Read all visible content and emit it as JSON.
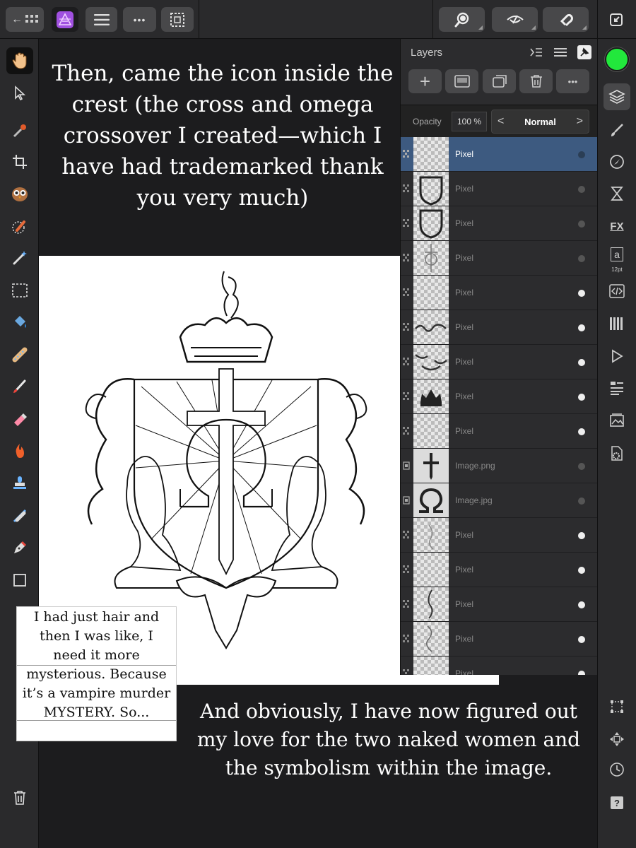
{
  "toolbar": {
    "back_label": "←",
    "more_label": "•••"
  },
  "colors": {
    "primary_color": "#22e83c",
    "selection": "#3d5a80"
  },
  "canvas": {
    "top_text": "Then, came the icon inside the crest (the cross and omega crossover I created—which I have had trademarked thank you very much)",
    "note_text": "I had just hair and then I was like, I need it more mysterious. Because it’s a vampire murder MYSTERY. So...",
    "bottom_text": "And obviously, I have now figured out my love for the two naked women and the symbolism within the image."
  },
  "layers_panel": {
    "title": "Layers",
    "opacity_label": "Opacity",
    "opacity_value": "100 %",
    "blend_mode": "Normal",
    "blend_prev": "<",
    "blend_next": ">",
    "add_label": "+",
    "more_label": "•••",
    "layers": [
      {
        "name": "Pixel",
        "selected": true
      },
      {
        "name": "Pixel"
      },
      {
        "name": "Pixel"
      },
      {
        "name": "Pixel"
      },
      {
        "name": "Pixel"
      },
      {
        "name": "Pixel"
      },
      {
        "name": "Pixel"
      },
      {
        "name": "Pixel"
      },
      {
        "name": "Pixel"
      },
      {
        "name": "Image.png"
      },
      {
        "name": "Image.jpg"
      },
      {
        "name": "Pixel"
      },
      {
        "name": "Pixel"
      },
      {
        "name": "Pixel"
      },
      {
        "name": "Pixel"
      },
      {
        "name": "Pixel"
      }
    ]
  },
  "studio": {
    "text_size": "12pt",
    "text_glyph": "a",
    "help_glyph": "?",
    "fx_label": "FX"
  }
}
